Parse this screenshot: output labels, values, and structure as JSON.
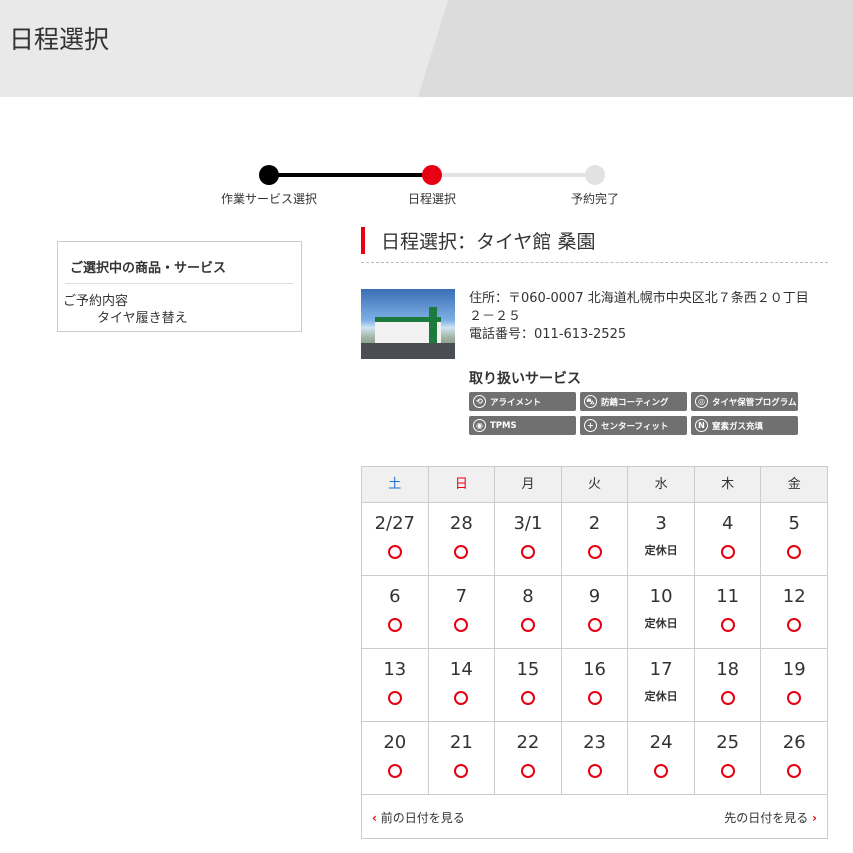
{
  "header": {
    "title": "日程選択"
  },
  "stepper": {
    "steps": [
      {
        "label": "作業サービス選択",
        "state": "done"
      },
      {
        "label": "日程選択",
        "state": "current"
      },
      {
        "label": "予約完了",
        "state": "todo"
      }
    ]
  },
  "sidebar": {
    "title": "ご選択中の商品・サービス",
    "reservation_label": "ご予約内容",
    "reservation_value": "タイヤ履き替え"
  },
  "shop": {
    "heading": "日程選択：タイヤ館 桑園",
    "address_label": "住所：",
    "address": "〒060-0007 北海道札幌市中央区北７条西２０丁目２－２５",
    "tel_label": "電話番号：",
    "tel": "011-613-2525",
    "services_title": "取り扱いサービス",
    "services": [
      {
        "label": "アライメント",
        "icon": "alignment-icon",
        "glyph": "⟲"
      },
      {
        "label": "防錆コーティング",
        "icon": "car-icon",
        "glyph": "⛍"
      },
      {
        "label": "タイヤ保管プログラム",
        "icon": "tire-icon",
        "glyph": "◎"
      },
      {
        "label": "TPMS",
        "icon": "tpms-icon",
        "glyph": "◉"
      },
      {
        "label": "センターフィット",
        "icon": "crosshair-icon",
        "glyph": "+"
      },
      {
        "label": "窒素ガス充填",
        "icon": "gas-icon",
        "glyph": "N"
      }
    ]
  },
  "calendar": {
    "weekdays": [
      "土",
      "日",
      "月",
      "火",
      "水",
      "木",
      "金"
    ],
    "closed_label": "定休日",
    "weeks": [
      [
        {
          "date": "2/27",
          "status": "available"
        },
        {
          "date": "28",
          "status": "available"
        },
        {
          "date": "3/1",
          "status": "available"
        },
        {
          "date": "2",
          "status": "available"
        },
        {
          "date": "3",
          "status": "closed"
        },
        {
          "date": "4",
          "status": "available"
        },
        {
          "date": "5",
          "status": "available"
        }
      ],
      [
        {
          "date": "6",
          "status": "available"
        },
        {
          "date": "7",
          "status": "available"
        },
        {
          "date": "8",
          "status": "available"
        },
        {
          "date": "9",
          "status": "available"
        },
        {
          "date": "10",
          "status": "closed"
        },
        {
          "date": "11",
          "status": "available"
        },
        {
          "date": "12",
          "status": "available"
        }
      ],
      [
        {
          "date": "13",
          "status": "available"
        },
        {
          "date": "14",
          "status": "available"
        },
        {
          "date": "15",
          "status": "available"
        },
        {
          "date": "16",
          "status": "available"
        },
        {
          "date": "17",
          "status": "closed"
        },
        {
          "date": "18",
          "status": "available"
        },
        {
          "date": "19",
          "status": "available"
        }
      ],
      [
        {
          "date": "20",
          "status": "available"
        },
        {
          "date": "21",
          "status": "available"
        },
        {
          "date": "22",
          "status": "available"
        },
        {
          "date": "23",
          "status": "available"
        },
        {
          "date": "24",
          "status": "available"
        },
        {
          "date": "25",
          "status": "available"
        },
        {
          "date": "26",
          "status": "available"
        }
      ]
    ],
    "prev_label": "前の日付を見る",
    "next_label": "先の日付を見る"
  },
  "colors": {
    "accent": "#e60012",
    "saturday": "#1e6fc8",
    "service_badge": "#707070"
  }
}
